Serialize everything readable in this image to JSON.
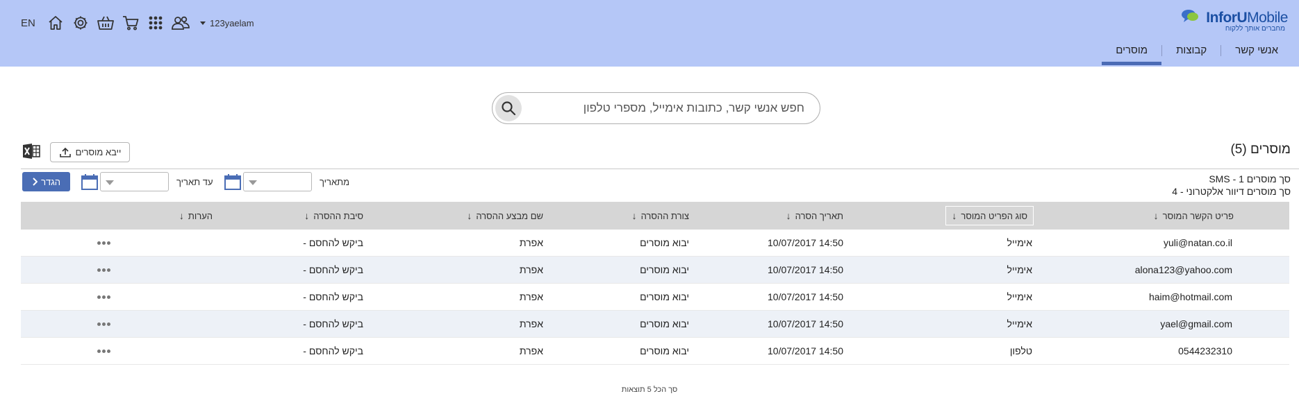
{
  "app": {
    "logo_brand": "InforU",
    "logo_brand2": "Mobile",
    "logo_tagline": "מחברים אותך ללקוח"
  },
  "nav": {
    "items": [
      {
        "label": "אנשי קשר",
        "active": false
      },
      {
        "label": "קבוצות",
        "active": false
      },
      {
        "label": "מוסרים",
        "active": true
      }
    ]
  },
  "toolbar": {
    "lang": "EN",
    "username": "123yaelam",
    "icons": [
      "home-icon",
      "settings-icon",
      "basket-icon",
      "cart-icon",
      "apps-grid-icon",
      "users-icon"
    ]
  },
  "search": {
    "placeholder": "חפש אנשי קשר, כתובות אימייל, מספרי טלפון",
    "value": ""
  },
  "section": {
    "title": "מוסרים (5)",
    "import_label": "ייבא מוסרים",
    "sms_total": "סך מוסרים SMS - 1",
    "email_total": "סך מוסרים דיוור אלקטרוני - 4"
  },
  "filters": {
    "from_label": "מתאריך",
    "to_label": "עד תאריך",
    "from_value": "",
    "to_value": "",
    "apply_label": "הגדר"
  },
  "table": {
    "headers": {
      "contact": "פריט הקשר המוסר",
      "type": "סוג הפריט המוסר",
      "date": "תאריך הסרה",
      "method": "צורת ההסרה",
      "by": "שם מבצע ההסרה",
      "reason": "סיבת ההסרה",
      "notes": "הערות"
    },
    "sort_arrow": "↓",
    "rows": [
      {
        "contact": "yuli@natan.co.il",
        "type": "אימייל",
        "date": "10/07/2017 14:50",
        "method": "יבוא מוסרים",
        "by": "אפרת",
        "reason": "ביקש להחסם -",
        "notes": ""
      },
      {
        "contact": "alona123@yahoo.com",
        "type": "אימייל",
        "date": "10/07/2017 14:50",
        "method": "יבוא מוסרים",
        "by": "אפרת",
        "reason": "ביקש להחסם -",
        "notes": ""
      },
      {
        "contact": "haim@hotmail.com",
        "type": "אימייל",
        "date": "10/07/2017 14:50",
        "method": "יבוא מוסרים",
        "by": "אפרת",
        "reason": "ביקש להחסם -",
        "notes": ""
      },
      {
        "contact": "yael@gmail.com",
        "type": "אימייל",
        "date": "10/07/2017 14:50",
        "method": "יבוא מוסרים",
        "by": "אפרת",
        "reason": "ביקש להחסם -",
        "notes": ""
      },
      {
        "contact": "0544232310",
        "type": "טלפון",
        "date": "10/07/2017 14:50",
        "method": "יבוא מוסרים",
        "by": "אפרת",
        "reason": "ביקש להחסם -",
        "notes": ""
      }
    ]
  },
  "footer": {
    "total_text": "סך הכל 5 תוצאות"
  },
  "colors": {
    "header_bg": "#b5c7f7",
    "nav_active": "#4b6bb5",
    "apply_button": "#4a6db5",
    "row_alt": "#edf1f7",
    "table_header": "#d6d6d6"
  }
}
